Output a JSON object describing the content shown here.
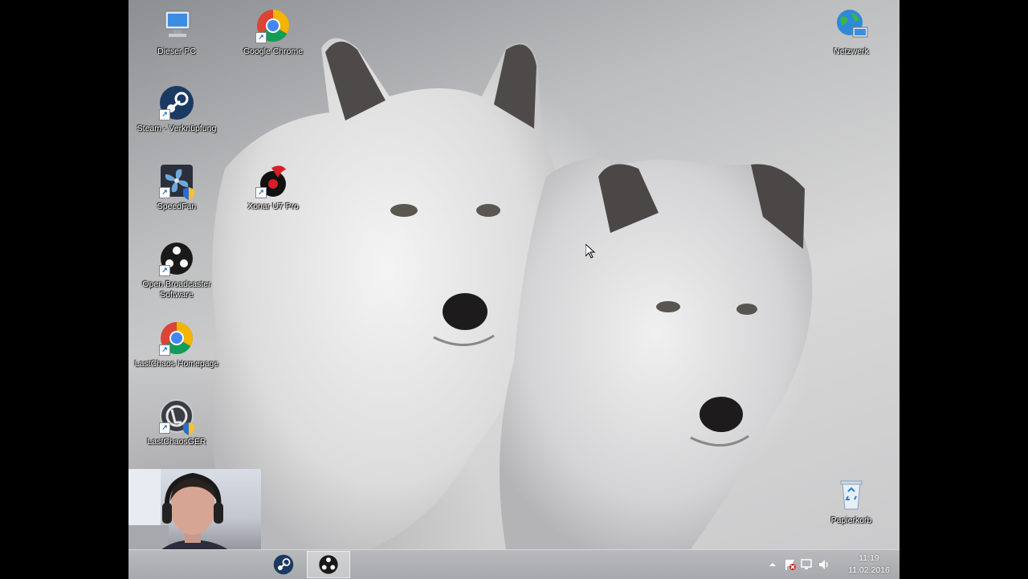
{
  "desktop": {
    "icons_left": [
      {
        "label": "Dieser PC",
        "icon": "computer-icon"
      },
      {
        "label": "Google Chrome",
        "icon": "chrome-icon"
      },
      {
        "label": "Steam - Verknüpfung",
        "icon": "steam-icon"
      },
      {
        "label": "SpeedFan",
        "icon": "fan-icon"
      },
      {
        "label": "Xonar U7 Pro",
        "icon": "audio-icon"
      },
      {
        "label": "Open Broadcaster Software",
        "icon": "obs-icon"
      },
      {
        "label": "LastChaos Homepage",
        "icon": "chrome-icon"
      },
      {
        "label": "LastChaosGER",
        "icon": "game-icon"
      }
    ],
    "icons_right": [
      {
        "label": "Netzwerk",
        "icon": "network-icon"
      },
      {
        "label": "Papierkorb",
        "icon": "recycle-bin-icon"
      }
    ]
  },
  "taskbar": {
    "pinned": [
      {
        "icon": "steam-icon"
      },
      {
        "icon": "obs-icon"
      }
    ],
    "tray": {
      "icons": [
        "tray-expand-icon",
        "flag-icon",
        "network-tray-icon",
        "volume-icon"
      ],
      "time": "11:19",
      "date": "11.02.2016"
    }
  },
  "colors": {
    "taskbar": "#adaeb1",
    "label_text": "#ffffff",
    "steam_blue": "#1b3a63",
    "chrome_red": "#db4437",
    "chrome_yellow": "#f4b400",
    "chrome_green": "#0f9d58",
    "chrome_blue": "#4285f4"
  }
}
